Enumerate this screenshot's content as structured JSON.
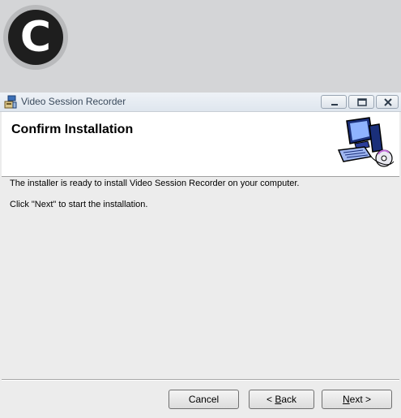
{
  "badge": {
    "letter": "C"
  },
  "window": {
    "title": "Video Session Recorder",
    "controls": {
      "minimize": "minimize",
      "maximize": "maximize",
      "close": "close"
    }
  },
  "header": {
    "title": "Confirm Installation"
  },
  "body": {
    "line1": "The installer is ready to install Video Session Recorder on your computer.",
    "line2": "Click \"Next\" to start the installation."
  },
  "buttons": {
    "cancel": "Cancel",
    "back_prefix": "< ",
    "back_mnemonic": "B",
    "back_rest": "ack",
    "next_mnemonic": "N",
    "next_rest": "ext >"
  },
  "icons": {
    "app": "installer-app-icon",
    "header": "computer-cd-icon"
  }
}
